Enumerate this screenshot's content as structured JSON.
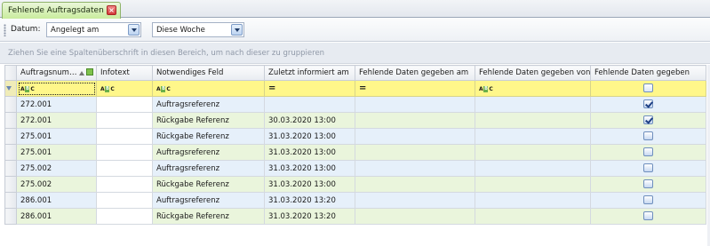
{
  "tab": {
    "title": "Fehlende Auftragsdaten",
    "close_icon": "close-icon"
  },
  "toolbar": {
    "label": "Datum:",
    "field_value": "Angelegt am",
    "period_value": "Diese Woche"
  },
  "group_panel": {
    "hint": "Ziehen Sie eine Spaltenüberschrift in diesen Bereich, um nach dieser zu gruppieren"
  },
  "grid": {
    "columns": [
      "Auftragsnum…",
      "Infotext",
      "Notwendiges Feld",
      "Zuletzt informiert am",
      "Fehlende Daten gegeben am",
      "Fehlende Daten gegeben von",
      "Fehlende Daten gegeben"
    ],
    "filter_ops": [
      "abc",
      "abc",
      "abc",
      "=",
      "=",
      "abc",
      "checkbox"
    ],
    "rows": [
      {
        "auftragsnummer": "272.001",
        "infotext": "",
        "notwendiges_feld": "Auftragsreferenz",
        "zuletzt_informiert": "",
        "gegeben_am": "",
        "gegeben_von": "",
        "gegeben": true
      },
      {
        "auftragsnummer": "272.001",
        "infotext": "",
        "notwendiges_feld": "Rückgabe Referenz",
        "zuletzt_informiert": "30.03.2020 13:00",
        "gegeben_am": "",
        "gegeben_von": "",
        "gegeben": true
      },
      {
        "auftragsnummer": "275.001",
        "infotext": "",
        "notwendiges_feld": "Rückgabe Referenz",
        "zuletzt_informiert": "31.03.2020 13:00",
        "gegeben_am": "",
        "gegeben_von": "",
        "gegeben": false
      },
      {
        "auftragsnummer": "275.001",
        "infotext": "",
        "notwendiges_feld": "Auftragsreferenz",
        "zuletzt_informiert": "31.03.2020 13:00",
        "gegeben_am": "",
        "gegeben_von": "",
        "gegeben": false
      },
      {
        "auftragsnummer": "275.002",
        "infotext": "",
        "notwendiges_feld": "Auftragsreferenz",
        "zuletzt_informiert": "31.03.2020 13:00",
        "gegeben_am": "",
        "gegeben_von": "",
        "gegeben": false
      },
      {
        "auftragsnummer": "275.002",
        "infotext": "",
        "notwendiges_feld": "Rückgabe Referenz",
        "zuletzt_informiert": "31.03.2020 13:00",
        "gegeben_am": "",
        "gegeben_von": "",
        "gegeben": false
      },
      {
        "auftragsnummer": "286.001",
        "infotext": "",
        "notwendiges_feld": "Auftragsreferenz",
        "zuletzt_informiert": "31.03.2020 13:20",
        "gegeben_am": "",
        "gegeben_von": "",
        "gegeben": false
      },
      {
        "auftragsnummer": "286.001",
        "infotext": "",
        "notwendiges_feld": "Rückgabe Referenz",
        "zuletzt_informiert": "31.03.2020 13:20",
        "gegeben_am": "",
        "gegeben_von": "",
        "gegeben": false
      }
    ]
  },
  "colors": {
    "tab_active": "#c9ec9d",
    "filter_row": "#fff78a",
    "row_odd": "#e6f0fa",
    "row_even": "#eaf5dc"
  }
}
